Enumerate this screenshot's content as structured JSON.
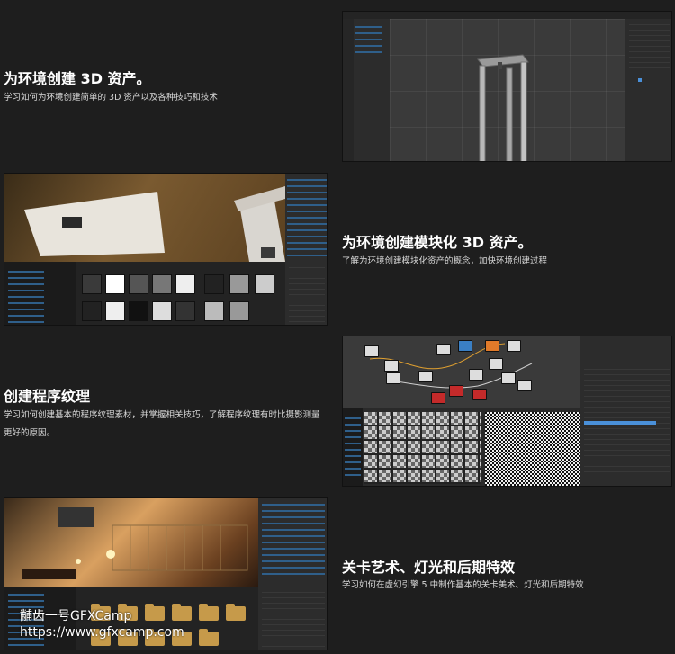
{
  "sections": [
    {
      "title": "为环境创建 3D 资产。",
      "desc": "学习如何为环境创建简单的 3D 资产以及各种技巧和技术"
    },
    {
      "title": "为环境创建模块化 3D 资产。",
      "desc": "了解为环境创建模块化资产的概念，加快环境创建过程"
    },
    {
      "title": "创建程序纹理",
      "desc": "学习如何创建基本的程序纹理素材，并掌握相关技巧，了解程序纹理有时比摄影测量更好的原因。"
    },
    {
      "title": "关卡艺术、灯光和后期特效",
      "desc": "学习如何在虚幻引擎 5 中制作基本的关卡美术、灯光和后期特效"
    }
  ],
  "watermark": {
    "line1": "黼齿一号GFXCamp",
    "line2": "https://www.gfxcamp.com"
  },
  "colors": {
    "background": "#1e1e1e",
    "folder": "#c69a4a",
    "node_red": "#c42a2a",
    "node_orange": "#e07a2a",
    "node_blue": "#3a7fc4"
  }
}
